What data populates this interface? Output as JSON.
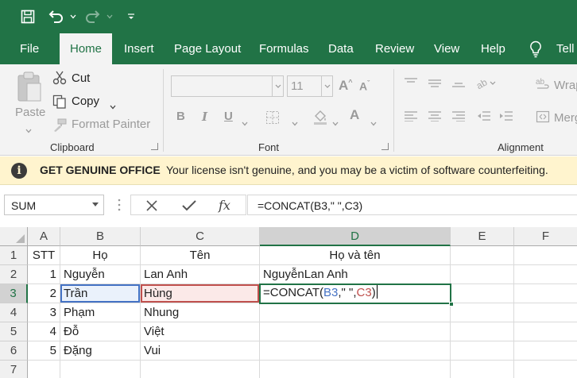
{
  "ribbon_tabs": [
    {
      "label": "File"
    },
    {
      "label": "Home"
    },
    {
      "label": "Insert"
    },
    {
      "label": "Page Layout"
    },
    {
      "label": "Formulas"
    },
    {
      "label": "Data"
    },
    {
      "label": "Review"
    },
    {
      "label": "View"
    },
    {
      "label": "Help"
    },
    {
      "label": "Tell"
    }
  ],
  "clipboard": {
    "paste": "Paste",
    "cut": "Cut",
    "copy": "Copy",
    "format_painter": "Format Painter",
    "group_label": "Clipboard"
  },
  "font": {
    "name": "",
    "size": "11",
    "group_label": "Font"
  },
  "alignment": {
    "wrap": "Wrap",
    "merge": "Merg",
    "group_label": "Alignment"
  },
  "banner": {
    "title": "GET GENUINE OFFICE",
    "message": "Your license isn't genuine, and you may be a victim of software counterfeiting."
  },
  "formula_bar": {
    "name_box": "SUM",
    "fx": "fx",
    "formula": "=CONCAT(B3,\" \",C3)"
  },
  "columns": [
    "A",
    "B",
    "C",
    "D",
    "E",
    "F"
  ],
  "rows": [
    {
      "num": "1",
      "A": "STT",
      "B": "Họ",
      "C": "Tên",
      "D": "Họ và tên"
    },
    {
      "num": "2",
      "A": "1",
      "B": "Nguyễn",
      "C": "Lan Anh",
      "D": "NguyễnLan Anh"
    },
    {
      "num": "3",
      "A": "2",
      "B": "Trần",
      "C": "Hùng",
      "D": ""
    },
    {
      "num": "4",
      "A": "3",
      "B": "Phạm",
      "C": "Nhung",
      "D": ""
    },
    {
      "num": "5",
      "A": "4",
      "B": "Đỗ",
      "C": "Việt",
      "D": ""
    },
    {
      "num": "6",
      "A": "5",
      "B": "Đặng",
      "C": "Vui",
      "D": ""
    },
    {
      "num": "7",
      "A": "",
      "B": "",
      "C": "",
      "D": ""
    }
  ],
  "active_cell": {
    "prefix": "=CONCAT(",
    "ref1": "B3",
    "middle": ",\" \",",
    "ref2": "C3",
    "suffix": ")"
  },
  "colors": {
    "accent": "#217346",
    "ref1": "#4472c4",
    "ref2": "#c0504d"
  }
}
